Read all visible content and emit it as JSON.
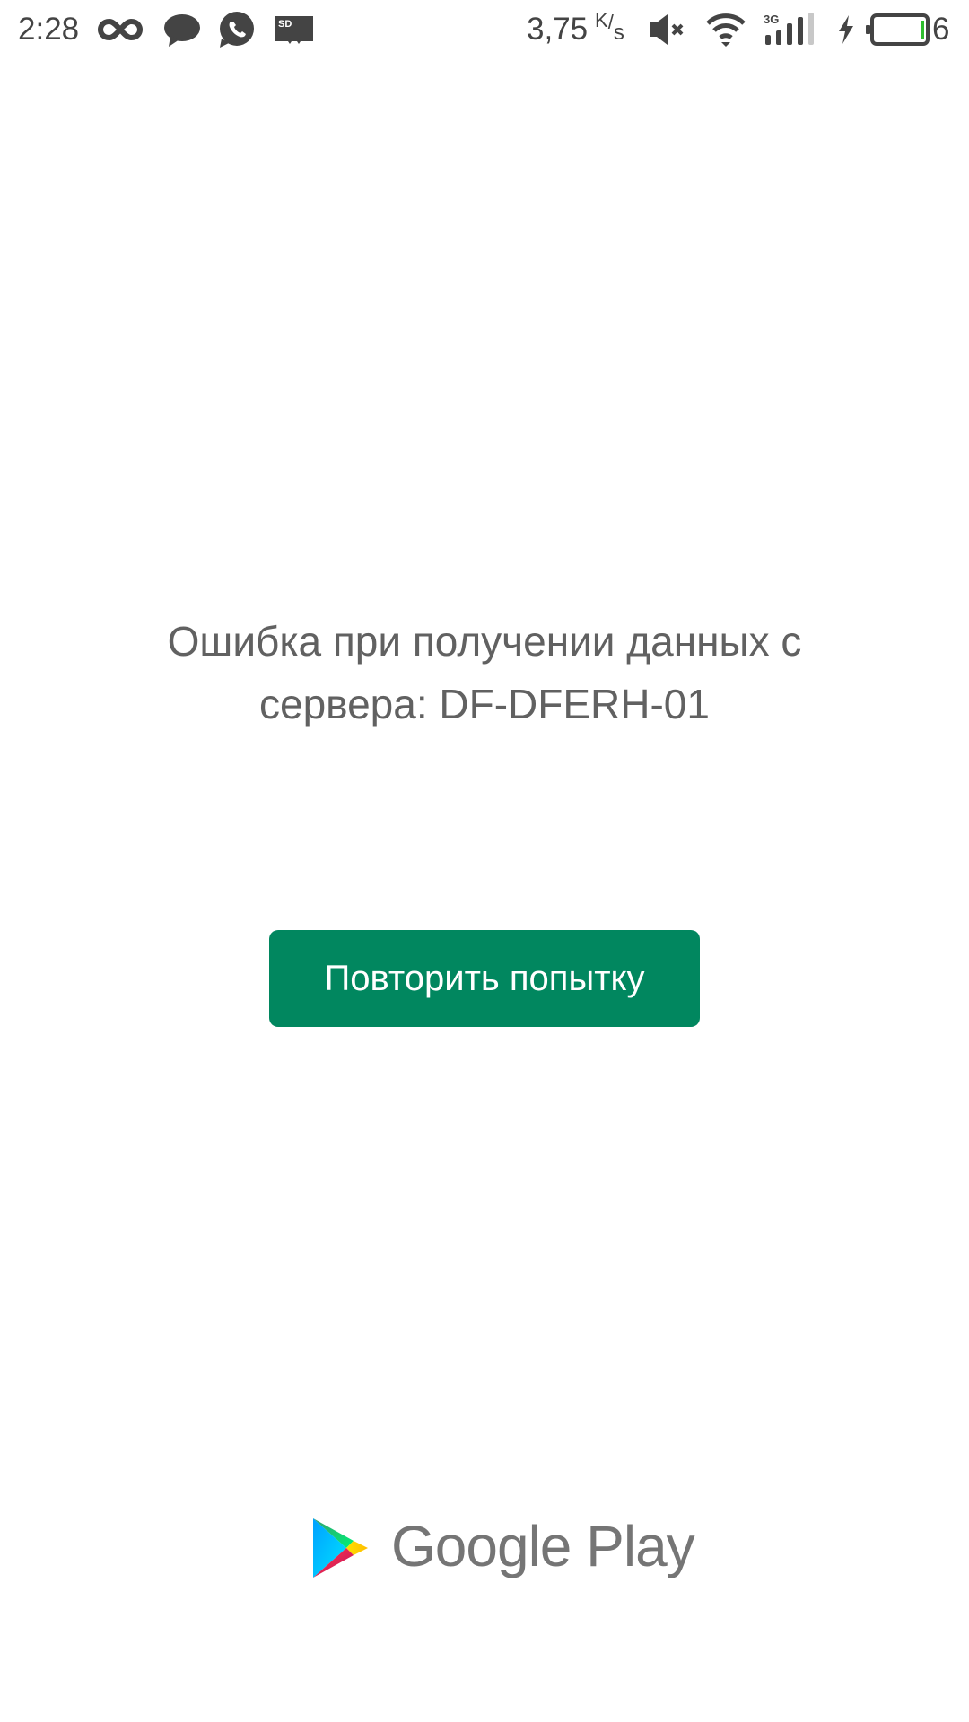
{
  "status_bar": {
    "time": "2:28",
    "notification_icons": [
      "infinity-icon",
      "chat-bubble-icon",
      "whatsapp-icon",
      "sd-card-icon"
    ],
    "sd_label": "SD",
    "net_speed": "3,75",
    "net_speed_unit_k": "K",
    "net_speed_unit_slash": "/",
    "net_speed_unit_s": "s",
    "network_type": "3G",
    "signal_bars": 4,
    "signal_bars_max": 5,
    "battery_level": "6",
    "battery_color": "#2ebd2e",
    "charging": true,
    "muted": true,
    "wifi": true
  },
  "main": {
    "error_message": "Ошибка при получении данных с сервера: DF-DFERH-01",
    "retry_button_label": "Повторить попытку",
    "accent_color": "#01875f"
  },
  "branding": {
    "name": "Google Play"
  }
}
